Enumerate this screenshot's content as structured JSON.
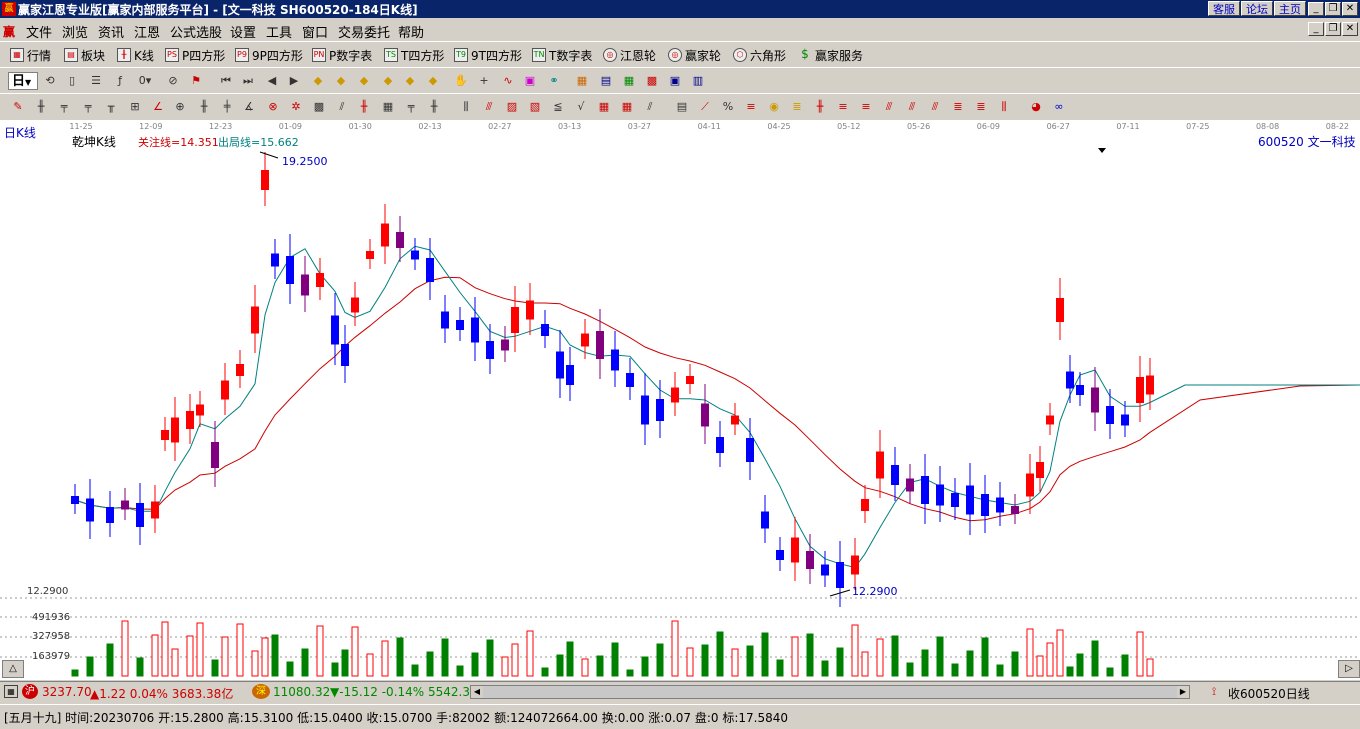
{
  "window": {
    "title": "赢家江恩专业版[赢家内部服务平台] - [文一科技  SH600520-184日K线]",
    "buttons": [
      "客服",
      "论坛",
      "主页"
    ]
  },
  "menu": [
    "文件",
    "浏览",
    "资讯",
    "江恩",
    "公式选股",
    "设置",
    "工具",
    "窗口",
    "交易委托",
    "帮助"
  ],
  "toolbar1": [
    "行情",
    "板块",
    "K线",
    "P四方形",
    "9P四方形",
    "P数字表",
    "T四方形",
    "9T四方形",
    "T数字表",
    "江恩轮",
    "赢家轮",
    "六角形",
    "赢家服务"
  ],
  "toolbar1_icons": [
    "table-icon",
    "sector-icon",
    "kline-icon",
    "ps-icon",
    "p9-icon",
    "pn-icon",
    "ts-icon",
    "t9-icon",
    "tn-icon",
    "gann-wheel-icon",
    "winner-wheel-icon",
    "hexagon-icon",
    "dollar-icon"
  ],
  "period_select": "日",
  "chart": {
    "period_label": "日K线",
    "indicator_name": "乾坤K线",
    "focus_line": "关注线=14.351",
    "exit_line": "出局线=15.662",
    "stock_label": "600520 文一科技",
    "high_label": "19.2500",
    "low_label": "12.2900",
    "left_low_label": "12.2900",
    "volume_labels": [
      "491936",
      "327958",
      "163979"
    ],
    "date_ticks": [
      "11-25",
      "12-09",
      "12-23",
      "01-09",
      "01-30",
      "02-13",
      "02-27",
      "03-13",
      "03-27",
      "04-11",
      "04-25",
      "05-12",
      "05-26",
      "06-09",
      "06-27",
      "07-11",
      "07-25",
      "08-08",
      "08-22"
    ],
    "colors": {
      "up": "#ff0000",
      "down": "#0000ff",
      "neutral": "#800080",
      "ma_short": "#008080",
      "ma_long": "#cc0000",
      "vol_up": "#ff0000",
      "vol_down": "#008000"
    }
  },
  "index_bar": {
    "sh_badge": "沪",
    "sh_value": "3237.70",
    "sh_change": "▲1.22 0.04% 3683.38亿",
    "sz_badge": "深",
    "sz_value": "11080.32",
    "sz_change": "▼-15.12 -0.14% 5542.3",
    "right_text": "收600520日线"
  },
  "status_bar": "[五月十九] 时间:20230706 开:15.2800 高:15.3100 低:15.0400 收:15.0700 手:82002 额:124072664.00 换:0.00 涨:0.07 盘:0 标:17.5840"
}
